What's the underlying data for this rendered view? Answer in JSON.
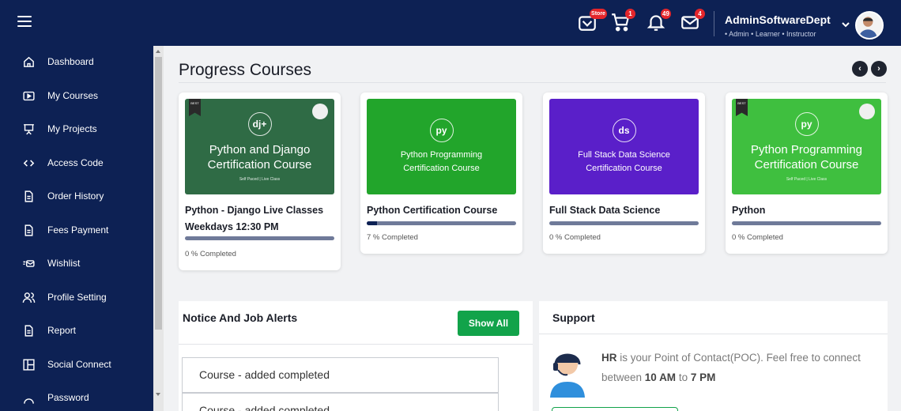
{
  "header": {
    "badges": {
      "store": "Store",
      "cart": "1",
      "bell": "49",
      "mail": "4"
    },
    "user_name": "AdminSoftwareDept",
    "user_roles": "• Admin • Learner • Instructor"
  },
  "sidebar": {
    "items": [
      {
        "label": "Dashboard",
        "icon": "home-icon"
      },
      {
        "label": "My Courses",
        "icon": "play-box-icon"
      },
      {
        "label": "My Projects",
        "icon": "presentation-icon"
      },
      {
        "label": "Access Code",
        "icon": "code-icon"
      },
      {
        "label": "Order History",
        "icon": "document-icon"
      },
      {
        "label": "Fees Payment",
        "icon": "document-icon"
      },
      {
        "label": "Wishlist",
        "icon": "wishlist-icon"
      },
      {
        "label": "Profile Setting",
        "icon": "users-icon"
      },
      {
        "label": "Report",
        "icon": "document-icon"
      },
      {
        "label": "Social Connect",
        "icon": "layout-icon"
      },
      {
        "label": "Password",
        "icon": "lock-icon"
      }
    ]
  },
  "main": {
    "section_title": "Progress Courses",
    "prev_label": "‹",
    "next_label": "›",
    "courses": [
      {
        "image_title": "Python and Django Certification Course",
        "image_sub": "Self Paced | Live Class",
        "logo": "dj+",
        "title": "Python - Django Live Classes Weekdays 12:30 PM",
        "progress": 0,
        "progress_label": "0 % Completed",
        "bg": "#2f6b45"
      },
      {
        "image_title": "Python Programming Certification Course",
        "image_sub": "",
        "logo": "py",
        "title": "Python Certification Course",
        "progress": 7,
        "progress_label": "7 % Completed",
        "bg": "#22a52b"
      },
      {
        "image_title": "Full Stack Data Science Certification Course",
        "image_sub": "",
        "logo": "ds",
        "title": "Full Stack Data Science",
        "progress": 0,
        "progress_label": "0 % Completed",
        "bg": "#5a1fc9"
      },
      {
        "image_title": "Python Programming Certification Course",
        "image_sub": "Self Paced | Live Class",
        "logo": "py",
        "title": "Python",
        "progress": 0,
        "progress_label": "0 % Completed",
        "bg": "#3fbf3f"
      }
    ],
    "notice": {
      "title": "Notice And Job Alerts",
      "show_all": "Show All",
      "items": [
        "Course - added completed",
        "Course - added completed"
      ]
    },
    "support": {
      "title": "Support",
      "hr": "HR",
      "text1": " is your Point of Contact(POC). Feel free to connect between ",
      "time1": "10 AM",
      "to": " to ",
      "time2": "7 PM"
    }
  }
}
